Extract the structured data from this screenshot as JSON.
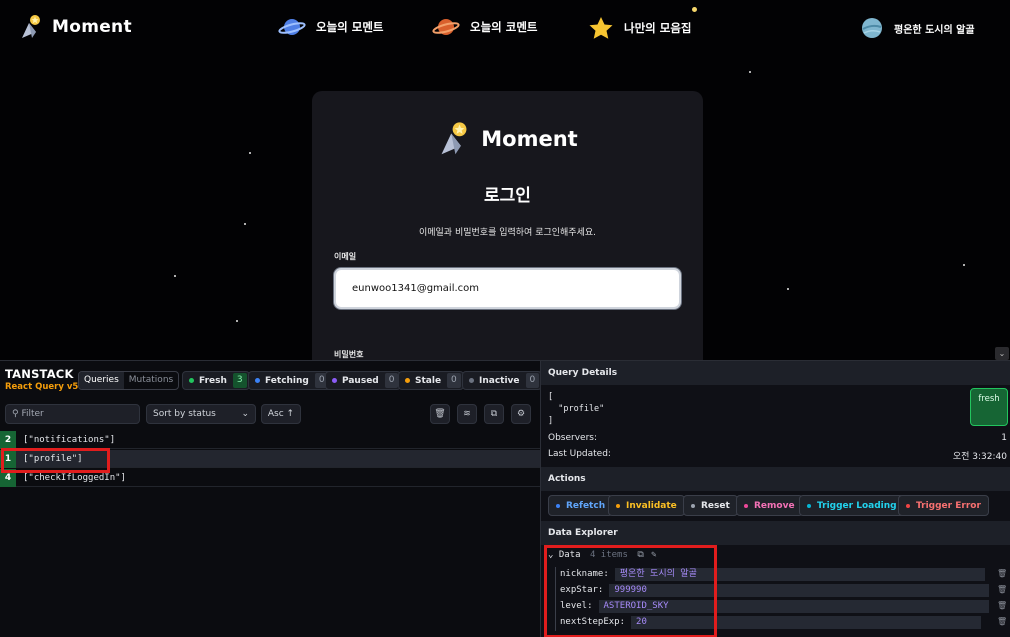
{
  "nav": {
    "brand": "Moment",
    "items": [
      {
        "label": "오늘의 모멘트",
        "icon": "planet-blue-icon"
      },
      {
        "label": "오늘의 코멘트",
        "icon": "planet-orange-icon"
      },
      {
        "label": "나만의 모음집",
        "icon": "star-icon"
      },
      {
        "label": "평온한 도시의 알골",
        "icon": "planet-teal-icon"
      }
    ]
  },
  "login": {
    "brand": "Moment",
    "title": "로그인",
    "description": "이메일과 비밀번호를 입력하여 로그인해주세요.",
    "email_label": "이메일",
    "email_value": "eunwoo1341@gmail.com",
    "password_label": "비밀번호"
  },
  "devtools": {
    "logo": "TANSTACK",
    "sublogo": "React Query v5",
    "tabs": {
      "queries": "Queries",
      "mutations": "Mutations"
    },
    "statuses": [
      {
        "label": "Fresh",
        "count": "3",
        "color": "#22c55e"
      },
      {
        "label": "Fetching",
        "count": "0",
        "color": "#3b82f6"
      },
      {
        "label": "Paused",
        "count": "0",
        "color": "#8b5cf6"
      },
      {
        "label": "Stale",
        "count": "0",
        "color": "#f59e0b"
      },
      {
        "label": "Inactive",
        "count": "0",
        "color": "#6b7280"
      }
    ],
    "filter_placeholder": "Filter",
    "sort_label": "Sort by status",
    "order_label": "Asc ↑",
    "queries": [
      {
        "observers": "2",
        "key": "[\"notifications\"]"
      },
      {
        "observers": "1",
        "key": "[\"profile\"]"
      },
      {
        "observers": "4",
        "key": "[\"checkIfLoggedIn\"]"
      }
    ]
  },
  "details": {
    "section_title": "Query Details",
    "query_key_text": "[\n  \"profile\"\n]",
    "status_badge": "fresh",
    "observers_label": "Observers:",
    "observers_value": "1",
    "updated_label": "Last Updated:",
    "updated_value": "오전 3:32:40",
    "actions_title": "Actions",
    "actions": [
      {
        "label": "Refetch",
        "color": "#3b82f6"
      },
      {
        "label": "Invalidate",
        "color": "#f59e0b"
      },
      {
        "label": "Reset",
        "color": "#9ca3af"
      },
      {
        "label": "Remove",
        "color": "#ec4899"
      },
      {
        "label": "Trigger Loading",
        "color": "#06b6d4"
      },
      {
        "label": "Trigger Error",
        "color": "#ef4444"
      }
    ],
    "explorer_title": "Data Explorer",
    "data_label": "Data",
    "data_count": "4 items",
    "fields": [
      {
        "key": "nickname:",
        "value": "평온한 도시의 알골"
      },
      {
        "key": "expStar:",
        "value": "999990"
      },
      {
        "key": "level:",
        "value": "ASTEROID_SKY"
      },
      {
        "key": "nextStepExp:",
        "value": "20"
      }
    ]
  }
}
